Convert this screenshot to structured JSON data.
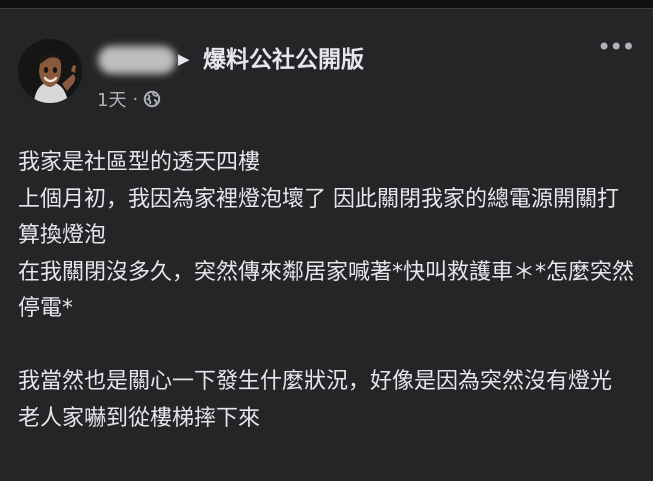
{
  "post": {
    "author_name": "",
    "group_name": "爆料公社公開版",
    "time_label": "1天",
    "audience_icon": "globe-icon",
    "more_label": "•••",
    "paragraphs": [
      "我家是社區型的透天四樓",
      "上個月初，我因為家裡燈泡壞了 因此關閉我家的總電源開關打算換燈泡",
      "在我關閉沒多久，突然傳來鄰居家喊著*快叫救護車＊*怎麼突然停電*",
      "",
      "我當然也是關心一下發生什麼狀況，好像是因為突然沒有燈光 老人家嚇到從樓梯摔下來"
    ]
  },
  "colors": {
    "background": "#18191a",
    "card": "#242526",
    "primary_text": "#e4e6eb",
    "secondary_text": "#b0b3b8"
  }
}
